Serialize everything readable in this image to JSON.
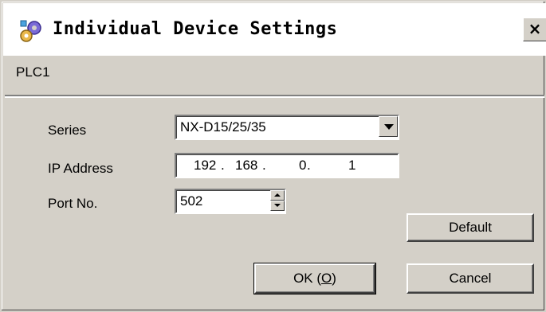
{
  "window": {
    "title": "Individual Device Settings",
    "close_glyph": "×"
  },
  "device": {
    "name": "PLC1"
  },
  "fields": {
    "series_label": "Series",
    "series_value": "NX-D15/25/35",
    "ip_label": "IP Address",
    "ip_octets": [
      "192",
      "168",
      "0",
      "1"
    ],
    "port_label": "Port No.",
    "port_value": "502"
  },
  "buttons": {
    "default_label": "Default",
    "ok_label_prefix": "OK (",
    "ok_mnemonic": "O",
    "ok_label_suffix": ")",
    "cancel_label": "Cancel"
  },
  "icons": {
    "title_icon": "device-settings-icon",
    "series_dropdown": "chevron-down-icon",
    "port_spinner_up": "spin-up-icon",
    "port_spinner_down": "spin-down-icon"
  }
}
